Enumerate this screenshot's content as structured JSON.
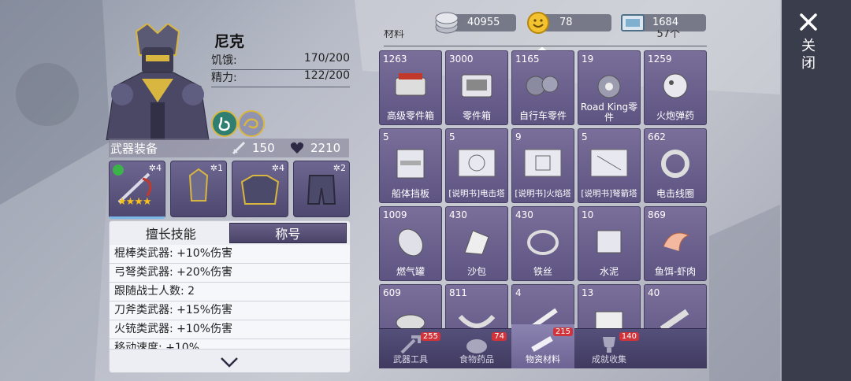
{
  "currency": [
    {
      "icon": "silver-coin-stack-icon",
      "value": "40955"
    },
    {
      "icon": "smiley-coin-icon",
      "value": "78"
    },
    {
      "icon": "ticket-icon",
      "value": "1684"
    }
  ],
  "close_label": "关闭",
  "character": {
    "name": "尼克",
    "stats": [
      {
        "label": "饥饿:",
        "value": "170/200"
      },
      {
        "label": "精力:",
        "value": "122/200"
      }
    ],
    "badges": [
      "stomach-icon",
      "dragon-icon"
    ]
  },
  "equipment": {
    "title": "武器装备",
    "attack": "150",
    "health": "2210",
    "slots": [
      {
        "name": "weapon",
        "level": "4",
        "stars": 4
      },
      {
        "name": "helmet",
        "level": "1"
      },
      {
        "name": "armor",
        "level": "4"
      },
      {
        "name": "pants",
        "level": "2"
      }
    ]
  },
  "skills": {
    "tabs": [
      "擅长技能",
      "称号"
    ],
    "active_tab": 1,
    "rows": [
      "棍棒类武器: +10%伤害",
      "弓弩类武器: +20%伤害",
      "跟随战士人数: 2",
      "刀斧类武器: +15%伤害",
      "火铳类武器: +10%伤害",
      "移动速度: +10%"
    ]
  },
  "inventory": {
    "header_left": "材料",
    "header_right": "57个",
    "items": [
      {
        "qty": "1263",
        "label": "高级零件箱"
      },
      {
        "qty": "3000",
        "label": "零件箱"
      },
      {
        "qty": "1165",
        "label": "自行车零件"
      },
      {
        "qty": "19",
        "label": "Road King零件"
      },
      {
        "qty": "1259",
        "label": "火炮弹药"
      },
      {
        "qty": "5",
        "label": "船体挡板"
      },
      {
        "qty": "5",
        "label": "[说明书]电击塔"
      },
      {
        "qty": "9",
        "label": "[说明书]火焰塔"
      },
      {
        "qty": "5",
        "label": "[说明书]弩箭塔"
      },
      {
        "qty": "662",
        "label": "电击线圈"
      },
      {
        "qty": "1009",
        "label": "燃气罐"
      },
      {
        "qty": "430",
        "label": "沙包"
      },
      {
        "qty": "430",
        "label": "铁丝"
      },
      {
        "qty": "10",
        "label": "水泥"
      },
      {
        "qty": "869",
        "label": "鱼饵-虾肉"
      },
      {
        "qty": "609",
        "label": ""
      },
      {
        "qty": "811",
        "label": ""
      },
      {
        "qty": "4",
        "label": ""
      },
      {
        "qty": "13",
        "label": ""
      },
      {
        "qty": "40",
        "label": ""
      }
    ]
  },
  "bottom_tabs": [
    {
      "label": "武器工具",
      "count": "255",
      "icon": "tools-icon"
    },
    {
      "label": "食物药品",
      "count": "74",
      "icon": "food-icon"
    },
    {
      "label": "物资材料",
      "count": "215",
      "icon": "materials-icon"
    },
    {
      "label": "成就收集",
      "count": "140",
      "icon": "trophy-icon"
    }
  ],
  "active_bottom_tab": 2
}
